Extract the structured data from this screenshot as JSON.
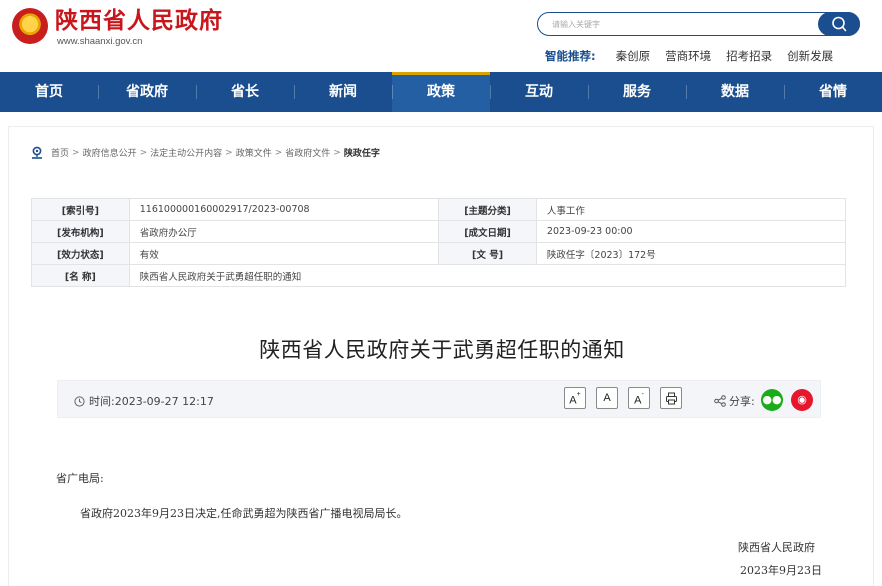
{
  "header": {
    "site_name": "陕西省人民政府",
    "site_url": "www.shaanxi.gov.cn",
    "search_placeholder": "请输入关键字",
    "smart_label": "智能推荐:",
    "smart_items": [
      "秦创原",
      "营商环境",
      "招考招录",
      "创新发展"
    ]
  },
  "nav": [
    "首页",
    "省政府",
    "省长",
    "新闻",
    "政策",
    "互动",
    "服务",
    "数据",
    "省情"
  ],
  "nav_active": "政策",
  "breadcrumb": {
    "items": [
      "首页",
      "政府信息公开",
      "法定主动公开内容",
      "政策文件",
      "省政府文件"
    ],
    "sep": ">",
    "current": "陕政任字"
  },
  "meta": {
    "index_label": "[索引号]",
    "index_value": "116100000160002917/2023-00708",
    "topic_label": "[主题分类]",
    "topic_value": "人事工作",
    "org_label": "[发布机构]",
    "org_value": "省政府办公厅",
    "date_label": "[成文日期]",
    "date_value": "2023-09-23 00:00",
    "status_label": "[效力状态]",
    "status_value": "有效",
    "docno_label": "[文      号]",
    "docno_value": "陕政任字〔2023〕172号",
    "name_label": "[名      称]",
    "name_value": "陕西省人民政府关于武勇超任职的通知"
  },
  "article": {
    "title": "陕西省人民政府关于武勇超任职的通知",
    "time_label": "时间:",
    "time_value": "2023-09-27 12:17",
    "share_label": "分享:",
    "font_buttons": [
      "A",
      "A",
      "A"
    ],
    "recipient": "省广电局:",
    "paragraph": "省政府2023年9月23日决定,任命武勇超为陕西省广播电视局局长。",
    "signature_org": "陕西省人民政府",
    "signature_date": "2023年9月23日"
  },
  "colors": {
    "brand_red": "#c8161d",
    "nav_blue": "#1a4e8e",
    "accent_gold": "#d9a400"
  }
}
